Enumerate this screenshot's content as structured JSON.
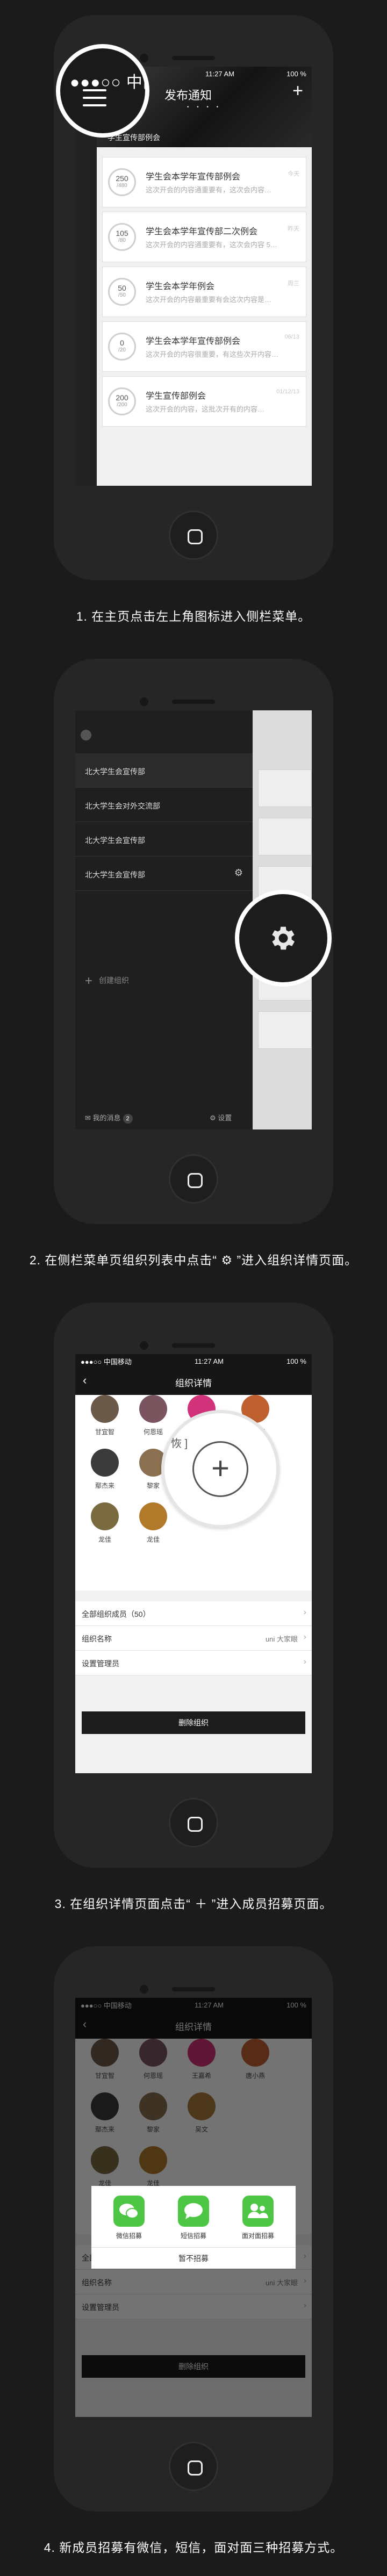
{
  "steps": [
    {
      "caption": "1. 在主页点击左上角图标进入侧栏菜单。"
    },
    {
      "caption": "2. 在侧栏菜单页组织列表中点击“ ⚙ ”进入组织详情页面。"
    },
    {
      "caption": "3. 在组织详情页面点击“ ＋ ”进入成员招募页面。"
    },
    {
      "caption": "4. 新成员招募有微信，短信，面对面三种招募方式。"
    }
  ],
  "status": {
    "signal": "●●●○○ 中国移动",
    "time": "11:27 AM",
    "battery": "100 %"
  },
  "screen1": {
    "zoom_label": "●●●○○ 中国",
    "title": "发布通知",
    "dots": "• • • •",
    "subtitle": "学生宣传部例会",
    "cards": [
      {
        "count": "250",
        "total": "/480",
        "title": "学生会本学年宣传部例会",
        "desc": "这次开会的内容通重要有，这次会内容…",
        "time": "今天"
      },
      {
        "count": "105",
        "total": "/80",
        "title": "学生会本学年宣传部二次例会",
        "desc": "这次开会的内容通重要有，这次会内容 5…",
        "time": "昨天"
      },
      {
        "count": "50",
        "total": "/50",
        "title": "学生会本学年例会",
        "desc": "这次开会的内容最重要有会这次内容是…",
        "time": "周三"
      },
      {
        "count": "0",
        "total": "/20",
        "title": "学生会本学年宣传部例会",
        "desc": "这次开会的内容很重要，有这些次开内容…",
        "time": "06/13"
      },
      {
        "count": "200",
        "total": "/200",
        "title": "学生宣传部例会",
        "desc": "这次开会的内容，这批次开有的内容…",
        "time": "01/12/13"
      }
    ]
  },
  "screen2": {
    "orgs": [
      "北大学生会宣传部",
      "北大学生会对外交流部",
      "北大学生会宣传部",
      "北大学生会宣传部"
    ],
    "add_label": "创建组织",
    "messages_label": "我的消息",
    "messages_count": "2",
    "settings_label": "设置"
  },
  "screen3": {
    "title": "组织详情",
    "members": [
      {
        "name": "甘宜智",
        "color": "#6b5a4a"
      },
      {
        "name": "何恩瑶",
        "color": "#7a5560"
      },
      {
        "name": "王嘉希",
        "color": "#d2327a"
      },
      {
        "name": "唐小燕",
        "color": "#c06030"
      },
      {
        "name": "鄢杰来",
        "color": "#3b3b3b"
      },
      {
        "name": "黎家",
        "color": "#8a7050"
      },
      {
        "name": "吴文",
        "color": "#a87a3a"
      },
      {
        "name": "龙佳",
        "color": "#7a6a40"
      },
      {
        "name": "龙佳",
        "color": "#b07a2a"
      }
    ],
    "zoom_fragment": "恢 ]",
    "plus": "+",
    "all_members": "全部组织成员（50）",
    "org_name_label": "组织名称",
    "org_name_value": "uni 大家眼",
    "admin_label": "设置管理员",
    "delete_label": "删除组织"
  },
  "screen4": {
    "options": [
      "微信招募",
      "短信招募",
      "面对面招募"
    ],
    "cancel": "暂不招募"
  }
}
